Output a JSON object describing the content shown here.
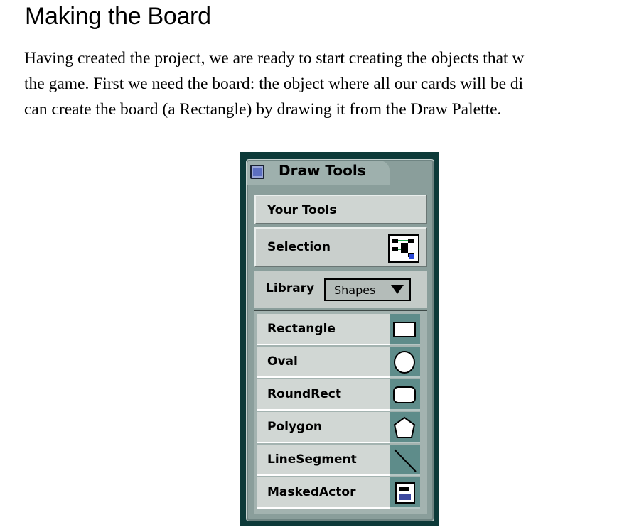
{
  "heading": "Making the Board",
  "paragraph": {
    "line1": "Having created the project, we are ready to start creating the objects that w",
    "line2": "the game. First we need the board: the object where all our cards will be di",
    "line3": "can create the board (a Rectangle) by drawing it from the Draw Palette."
  },
  "palette": {
    "title": "Draw Tools",
    "your_tools": "Your Tools",
    "selection": "Selection",
    "library_label": "Library",
    "library_value": "Shapes",
    "tools": [
      {
        "label": "Rectangle",
        "icon": "rectangle-icon"
      },
      {
        "label": "Oval",
        "icon": "oval-icon"
      },
      {
        "label": "RoundRect",
        "icon": "roundrect-icon"
      },
      {
        "label": "Polygon",
        "icon": "polygon-icon"
      },
      {
        "label": "LineSegment",
        "icon": "line-segment-icon"
      },
      {
        "label": "MaskedActor",
        "icon": "masked-actor-icon"
      }
    ]
  }
}
